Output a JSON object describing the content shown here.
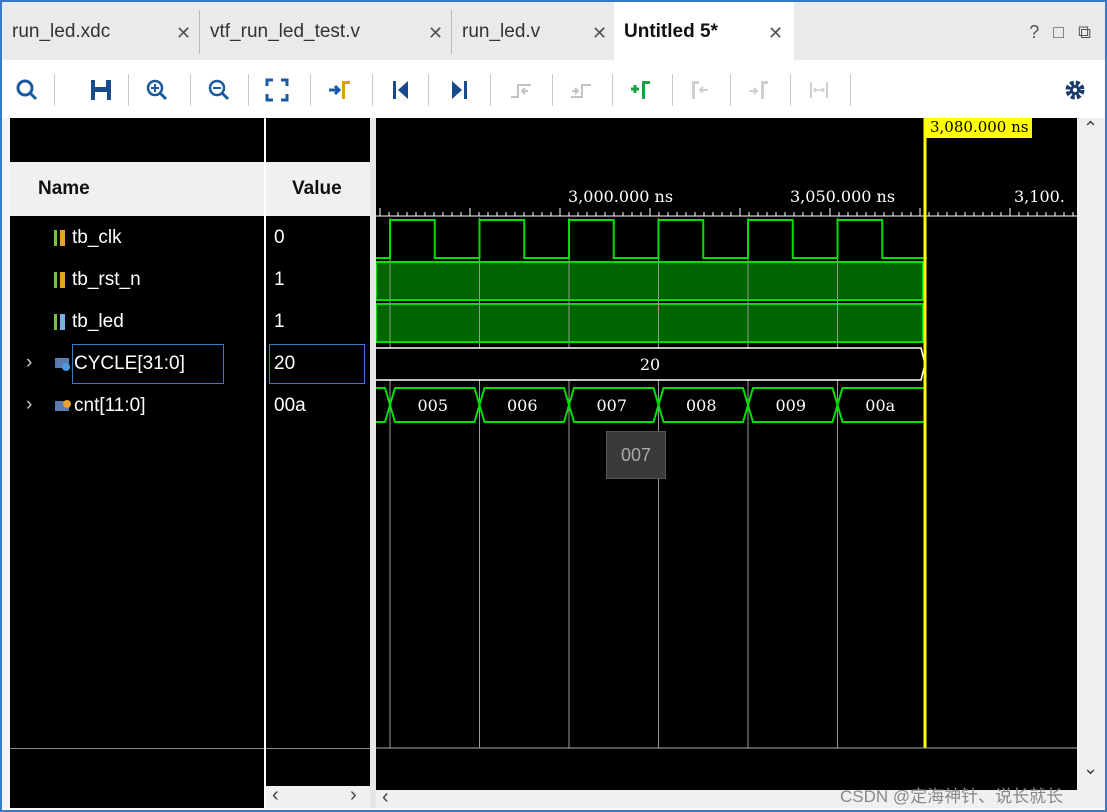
{
  "tabs": [
    {
      "label": "run_led.xdc",
      "active": false
    },
    {
      "label": "vtf_run_led_test.v",
      "active": false
    },
    {
      "label": "run_led.v",
      "active": false
    },
    {
      "label": "Untitled 5*",
      "active": true
    }
  ],
  "window_controls": {
    "help": "?",
    "restore": "□",
    "float": "⧉"
  },
  "toolbar_icons": [
    "search-icon",
    "save-icon",
    "zoom-in-icon",
    "zoom-out-icon",
    "zoom-fit-icon",
    "go-to-cursor-icon",
    "go-to-time-0-icon",
    "go-to-last-time-icon",
    "previous-transition-icon",
    "next-transition-icon",
    "add-marker-icon",
    "previous-marker-icon",
    "next-marker-icon",
    "swap-cursors-icon",
    "settings-icon"
  ],
  "columns": {
    "name": "Name",
    "value": "Value"
  },
  "signals": [
    {
      "name": "tb_clk",
      "value": "0",
      "icon": "bit-signal-icon",
      "expandable": false
    },
    {
      "name": "tb_rst_n",
      "value": "1",
      "icon": "bit-signal-icon",
      "expandable": false
    },
    {
      "name": "tb_led",
      "value": "1",
      "icon": "bit-signal-icon",
      "expandable": false
    },
    {
      "name": "CYCLE[31:0]",
      "value": "20",
      "icon": "parameter-bus-icon",
      "expandable": true,
      "selected": true
    },
    {
      "name": "cnt[11:0]",
      "value": "00a",
      "icon": "bus-icon",
      "expandable": true
    }
  ],
  "ruler": {
    "labels": [
      "3,000.000 ns",
      "3,050.000 ns",
      "3,100."
    ],
    "cursor_label": "3,080.000 ns"
  },
  "bus_values": {
    "cycle": "20",
    "cnt": [
      "005",
      "006",
      "007",
      "008",
      "009",
      "00a"
    ]
  },
  "tooltip": "007",
  "watermark": "CSDN @定海神针、说长就长",
  "colors": {
    "wave": "#00e000",
    "wave_fill": "#006400",
    "cursor": "#ffff00",
    "background": "#000000",
    "tab_border": "#3a78c8"
  }
}
